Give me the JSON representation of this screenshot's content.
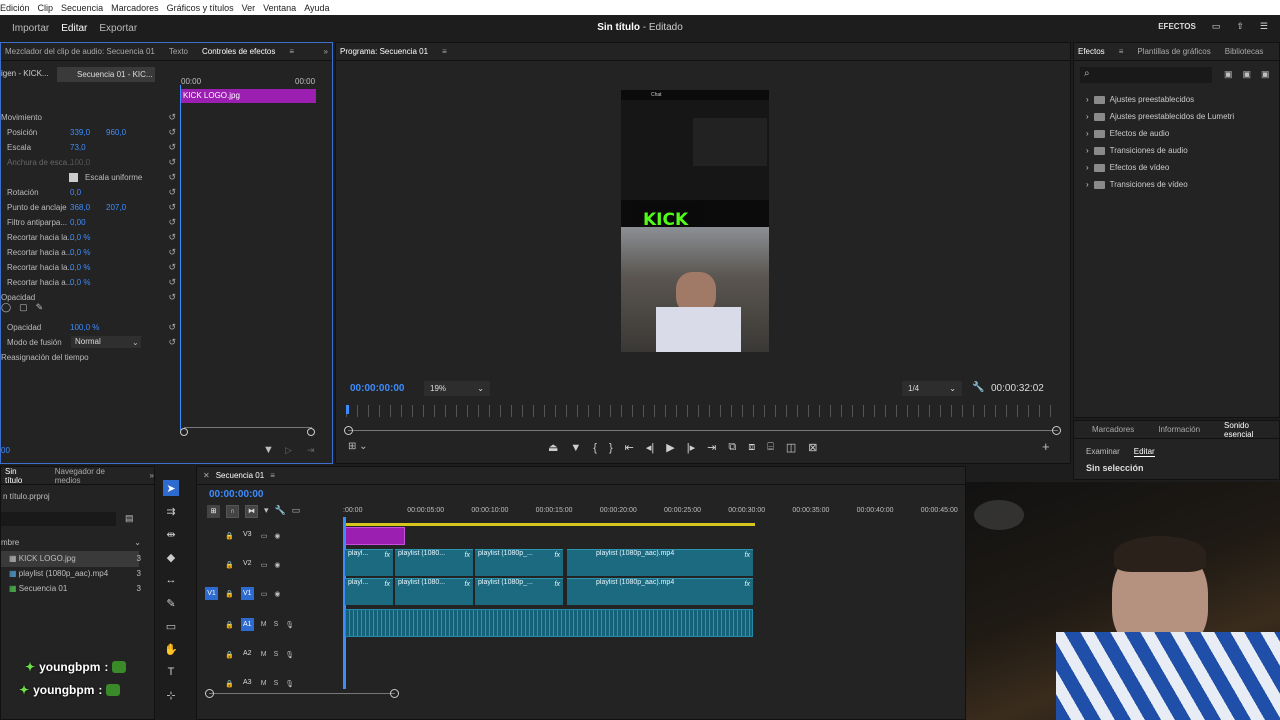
{
  "menu": [
    "Edición",
    "Clip",
    "Secuencia",
    "Marcadores",
    "Gráficos y títulos",
    "Ver",
    "Ventana",
    "Ayuda"
  ],
  "workspace": {
    "tabs": [
      "Importar",
      "Editar",
      "Exportar"
    ],
    "title_bold": "Sin título",
    "title_rest": " - Editado",
    "right_label": "EFECTOS"
  },
  "source_panel": {
    "tabs": [
      "Mezclador del clip de audio: Secuencia 01",
      "Texto",
      "Controles de efectos"
    ],
    "src_left": "igen - KICK...",
    "src_seq": "Secuencia 01 - KIC...",
    "time_start": "00:00",
    "time_end": "00:00",
    "clip_name": "KICK LOGO.jpg",
    "rows": [
      {
        "label": "Movimiento",
        "v1": "",
        "v2": ""
      },
      {
        "label": "Posición",
        "v1": "339,0",
        "v2": "960,0"
      },
      {
        "label": "Escala",
        "v1": "73,0",
        "v2": ""
      },
      {
        "label": "Anchura de esca...",
        "v1": "100,0",
        "v2": ""
      },
      {
        "label": "Escala uniforme",
        "v1": "",
        "v2": ""
      },
      {
        "label": "Rotación",
        "v1": "0,0",
        "v2": ""
      },
      {
        "label": "Punto de anclaje",
        "v1": "368,0",
        "v2": "207,0"
      },
      {
        "label": "Filtro antiparpa...",
        "v1": "0,00",
        "v2": ""
      },
      {
        "label": "Recortar hacia la...",
        "v1": "0,0 %",
        "v2": ""
      },
      {
        "label": "Recortar hacia a...",
        "v1": "0,0 %",
        "v2": ""
      },
      {
        "label": "Recortar hacia la...",
        "v1": "0,0 %",
        "v2": ""
      },
      {
        "label": "Recortar hacia a...",
        "v1": "0,0 %",
        "v2": ""
      },
      {
        "label": "Opacidad",
        "v1": "",
        "v2": ""
      },
      {
        "label": "Opacidad",
        "v1": "100,0 %",
        "v2": ""
      },
      {
        "label": "Modo de fusión",
        "v1": "Normal",
        "v2": ""
      },
      {
        "label": "Reasignación del tiempo",
        "v1": "",
        "v2": ""
      }
    ],
    "bottom_time": "00"
  },
  "program": {
    "title": "Programa: Secuencia 01",
    "timecode": "00:00:00:00",
    "zoom": "19%",
    "quality": "1/4",
    "duration": "00:00:32:02",
    "preview": {
      "logo_text": "KICK",
      "chat_header": "Chat"
    }
  },
  "effects_panel": {
    "tabs": [
      "Efectos",
      "Plantillas de gráficos",
      "Bibliotecas"
    ],
    "items": [
      "Ajustes preestablecidos",
      "Ajustes preestablecidos de Lumetri",
      "Efectos de audio",
      "Transiciones de audio",
      "Efectos de vídeo",
      "Transiciones de vídeo"
    ]
  },
  "essential_sound": {
    "tabs": [
      "Marcadores",
      "Información",
      "Sonido esencial"
    ],
    "subtabs": [
      "Examinar",
      "Editar"
    ],
    "status": "Sin selección"
  },
  "project": {
    "tabs": [
      "Sin título",
      "Navegador de medios"
    ],
    "file": "n título.prproj",
    "col_header": "mbre",
    "items": [
      {
        "name": "KICK LOGO.jpg",
        "count": "3"
      },
      {
        "name": "playlist (1080p_aac).mp4",
        "count": "3"
      },
      {
        "name": "Secuencia 01",
        "count": "3"
      }
    ]
  },
  "timeline": {
    "title": "Secuencia 01",
    "timecode": "00:00:00:00",
    "ruler": [
      ":00:00",
      "00:00:05:00",
      "00:00:10:00",
      "00:00:15:00",
      "00:00:20:00",
      "00:00:25:00",
      "00:00:30:00",
      "00:00:35:00",
      "00:00:40:00",
      "00:00:45:00"
    ],
    "tracks": [
      {
        "src": "",
        "name": "V3"
      },
      {
        "src": "",
        "name": "V2"
      },
      {
        "src": "V1",
        "name": "V1"
      },
      {
        "src": "",
        "name": "A1"
      },
      {
        "src": "",
        "name": "A2"
      },
      {
        "src": "",
        "name": "A3"
      }
    ],
    "clips_v2": [
      "playl...",
      "playlist (1080...",
      "playlist (1080p_...",
      "playlist (1080p_aac).mp4"
    ],
    "clips_v1": [
      "playl...",
      "playlist (1080...",
      "playlist (1080p_...",
      "playlist (1080p_aac).mp4"
    ]
  },
  "chat_overlay": [
    {
      "user": "youngbpm",
      "sep": ":"
    },
    {
      "user": "youngbpm",
      "sep": ":"
    }
  ]
}
